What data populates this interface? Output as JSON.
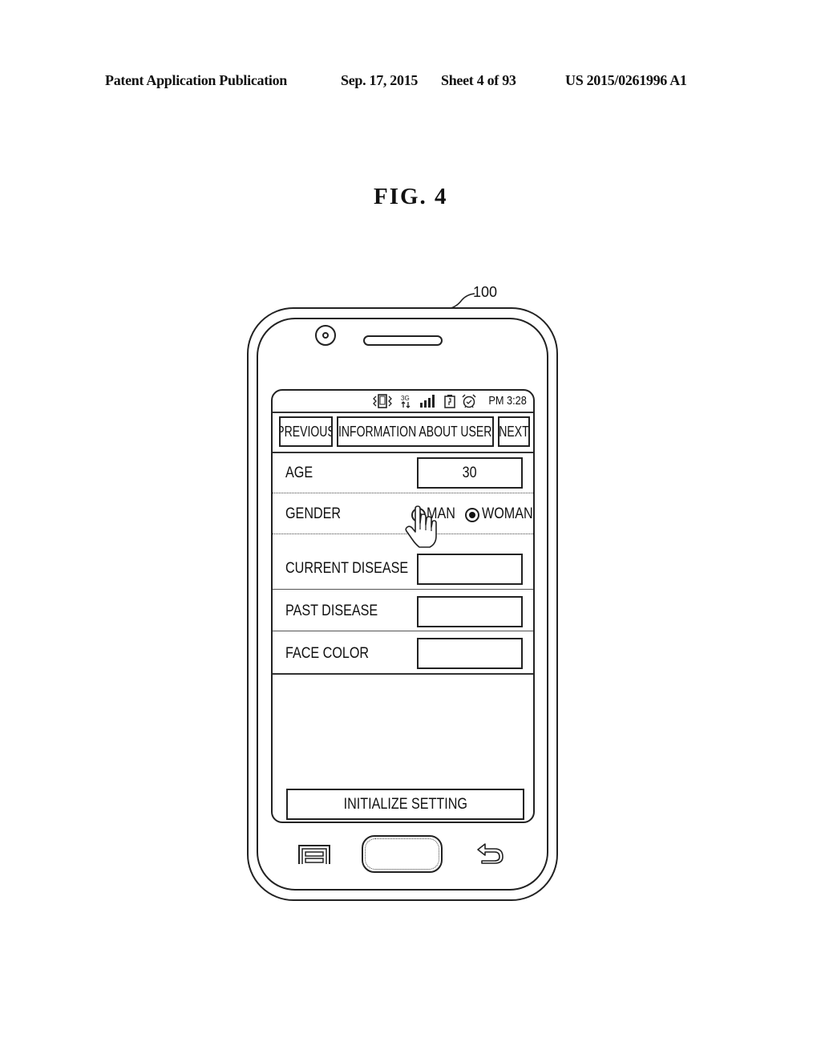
{
  "header": {
    "publication_label": "Patent Application Publication",
    "date": "Sep. 17, 2015",
    "sheet": "Sheet 4 of 93",
    "publication_number": "US 2015/0261996 A1"
  },
  "figure": {
    "title": "FIG.  4",
    "reference_numeral": "100"
  },
  "device": {
    "status_bar": {
      "icons": [
        "vibrate-icon",
        "3g-data-icon",
        "signal-strength-icon",
        "battery-icon",
        "alarm-clock-icon"
      ],
      "network_label": "3G",
      "time": "PM 3:28"
    },
    "nav": {
      "previous_label": "PREVIOUS",
      "title": "INFORMATION ABOUT USER",
      "next_label": "NEXT"
    },
    "form": {
      "age": {
        "label": "AGE",
        "value": "30"
      },
      "gender": {
        "label": "GENDER",
        "options": [
          {
            "label": "MAN",
            "selected": true
          },
          {
            "label": "WOMAN",
            "selected": true
          }
        ]
      },
      "current_disease": {
        "label": "CURRENT DISEASE",
        "value": ""
      },
      "past_disease": {
        "label": "PAST DISEASE",
        "value": ""
      },
      "face_color": {
        "label": "FACE COLOR",
        "value": ""
      }
    },
    "initialize_button_label": "INITIALIZE SETTING",
    "hardware_keys": [
      "menu-key",
      "home-key",
      "back-key"
    ]
  },
  "colors": {
    "line": "#222222",
    "background": "#ffffff"
  }
}
